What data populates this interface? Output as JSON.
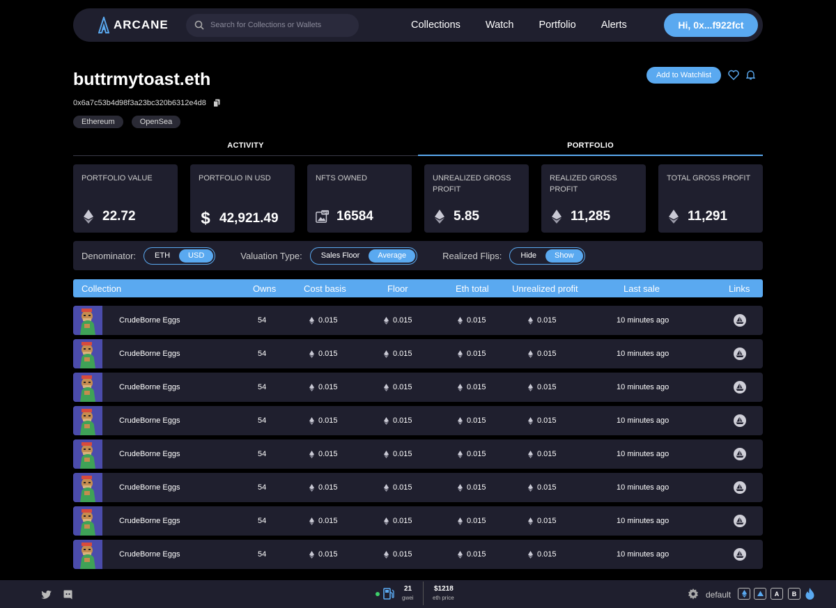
{
  "nav": {
    "logo": "ARCANE",
    "search_placeholder": "Search for Collections or Wallets",
    "links": [
      "Collections",
      "Watch",
      "Portfolio",
      "Alerts"
    ],
    "user": "Hi, 0x...f922fct"
  },
  "profile": {
    "name": "buttrmytoast.eth",
    "address": "0x6a7c53b4d98f3a23bc320b6312e4d8",
    "tags": [
      "Ethereum",
      "OpenSea"
    ],
    "watch_button": "Add to Watchlist"
  },
  "tabs": [
    "ACTIVITY",
    "PORTFOLIO"
  ],
  "cards": [
    {
      "label": "PORTFOLIO VALUE",
      "value": "22.72",
      "icon": "eth-icon"
    },
    {
      "label": "PORTFOLIO IN USD",
      "value": "42,921.49",
      "icon": "dollar-icon"
    },
    {
      "label": "NFTS OWNED",
      "value": "16584",
      "icon": "nft-icon"
    },
    {
      "label": "UNREALIZED GROSS PROFIT",
      "value": "5.85",
      "icon": "eth-icon"
    },
    {
      "label": "REALIZED GROSS PROFIT",
      "value": "11,285",
      "icon": "eth-icon"
    },
    {
      "label": "TOTAL GROSS PROFIT",
      "value": "11,291",
      "icon": "eth-icon"
    }
  ],
  "filters": {
    "denominator": {
      "label": "Denominator:",
      "options": [
        "ETH",
        "USD"
      ],
      "selected": "USD"
    },
    "valuation": {
      "label": "Valuation Type:",
      "options": [
        "Sales Floor",
        "Average"
      ],
      "selected": "Average"
    },
    "flips": {
      "label": "Realized Flips:",
      "options": [
        "Hide",
        "Show"
      ],
      "selected": "Show"
    }
  },
  "table": {
    "headers": [
      "Collection",
      "Owns",
      "Cost basis",
      "Floor",
      "Eth total",
      "Unrealized profit",
      "Last sale",
      "Links"
    ],
    "rows": [
      {
        "collection": "CrudeBorne Eggs",
        "owns": "54",
        "cost": "0.015",
        "floor": "0.015",
        "eth_total": "0.015",
        "unrealized": "0.015",
        "last_sale": "10 minutes ago"
      },
      {
        "collection": "CrudeBorne Eggs",
        "owns": "54",
        "cost": "0.015",
        "floor": "0.015",
        "eth_total": "0.015",
        "unrealized": "0.015",
        "last_sale": "10 minutes ago"
      },
      {
        "collection": "CrudeBorne Eggs",
        "owns": "54",
        "cost": "0.015",
        "floor": "0.015",
        "eth_total": "0.015",
        "unrealized": "0.015",
        "last_sale": "10 minutes ago"
      },
      {
        "collection": "CrudeBorne Eggs",
        "owns": "54",
        "cost": "0.015",
        "floor": "0.015",
        "eth_total": "0.015",
        "unrealized": "0.015",
        "last_sale": "10 minutes ago"
      },
      {
        "collection": "CrudeBorne Eggs",
        "owns": "54",
        "cost": "0.015",
        "floor": "0.015",
        "eth_total": "0.015",
        "unrealized": "0.015",
        "last_sale": "10 minutes ago"
      },
      {
        "collection": "CrudeBorne Eggs",
        "owns": "54",
        "cost": "0.015",
        "floor": "0.015",
        "eth_total": "0.015",
        "unrealized": "0.015",
        "last_sale": "10 minutes ago"
      },
      {
        "collection": "CrudeBorne Eggs",
        "owns": "54",
        "cost": "0.015",
        "floor": "0.015",
        "eth_total": "0.015",
        "unrealized": "0.015",
        "last_sale": "10 minutes ago"
      },
      {
        "collection": "CrudeBorne Eggs",
        "owns": "54",
        "cost": "0.015",
        "floor": "0.015",
        "eth_total": "0.015",
        "unrealized": "0.015",
        "last_sale": "10 minutes ago"
      }
    ]
  },
  "footer": {
    "gas_value": "21",
    "gas_unit": "gwei",
    "eth_price": "$1218",
    "eth_price_label": "eth price",
    "theme": "default",
    "keys": [
      "A",
      "B"
    ]
  },
  "colors": {
    "accent": "#5aa9f0",
    "panel": "#1f1f2e",
    "background": "#000000",
    "status_dot": "#3ecf6a"
  }
}
